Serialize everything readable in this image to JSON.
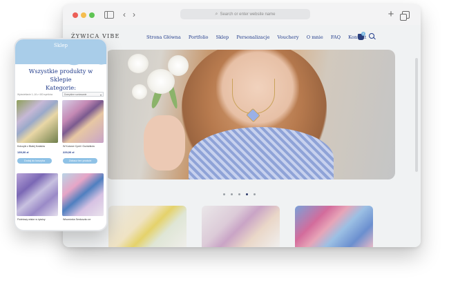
{
  "browser": {
    "address_placeholder": "Search or enter website name",
    "icons": [
      "sidebar-icon",
      "back-icon",
      "forward-icon",
      "plus-icon",
      "tabs-icon"
    ]
  },
  "site": {
    "logo": "ŻYWICA VIBE",
    "nav": [
      "Strona Główna",
      "Portfolio",
      "Sklep",
      "Personalizacje",
      "Vouchery",
      "O mnie",
      "FAQ",
      "Kontakt"
    ],
    "cart_count": "0",
    "carousel": {
      "slides": 5,
      "active_index": 3
    }
  },
  "phone": {
    "header_title": "Sklep",
    "heading_line1": "Wszystkie produkty w Sklepie",
    "heading_line2": "Kategorie:",
    "result_count": "Wyświetlanie 1–16 z 400 wyników",
    "sort_select": "Domyślne sortowanie",
    "products": [
      {
        "name": "Kolczyki z Białej Kwiatów",
        "price": "139,00 zł",
        "button": "Dodaj do koszyka"
      },
      {
        "name": "W Kolorze Cynii i Goździków",
        "price": "229,00 zł",
        "button": "Zobacz ten produkt"
      },
      {
        "name": "Fioletowy wisior w żywicy",
        "price": "",
        "button": ""
      },
      {
        "name": "Wisorówka Serduszko ze",
        "price": "",
        "button": ""
      }
    ]
  },
  "colors": {
    "brand_blue": "#1f3a8a",
    "sky": "#a9cde9",
    "button": "#8fc2e6"
  }
}
